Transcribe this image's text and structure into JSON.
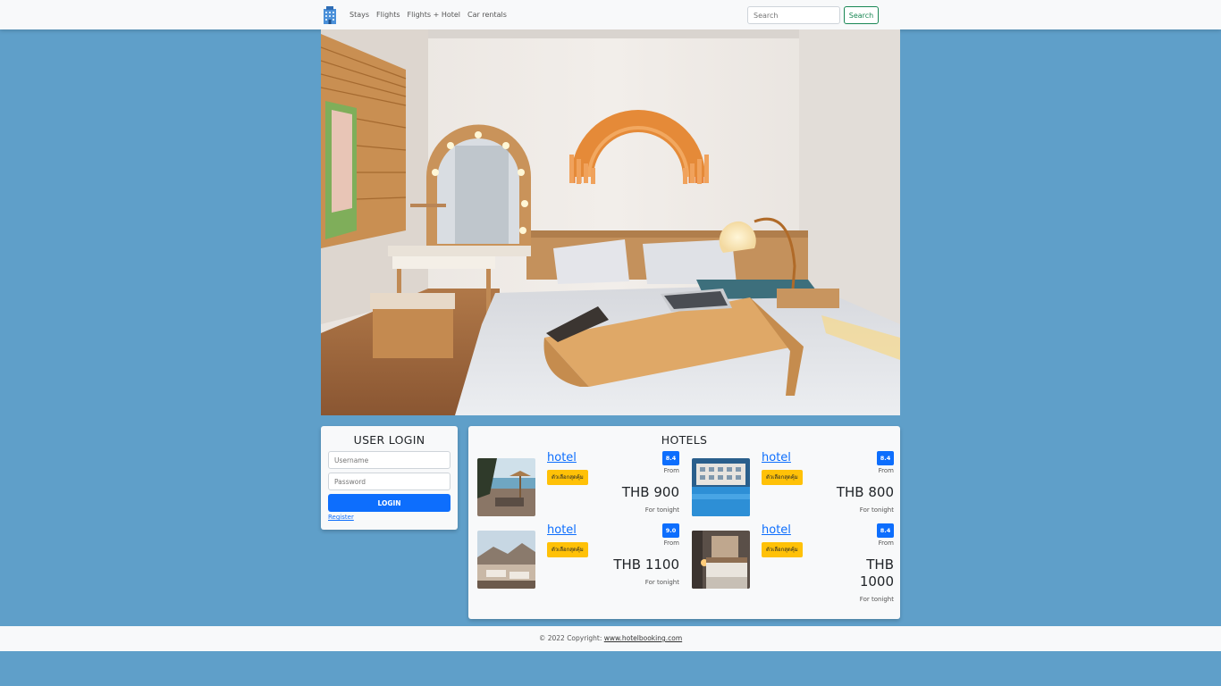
{
  "nav": {
    "items": [
      "Stays",
      "Flights",
      "Flights + Hotel",
      "Car rentals"
    ],
    "search_placeholder": "Search",
    "search_button": "Search"
  },
  "login": {
    "title": "USER LOGIN",
    "username_placeholder": "Username",
    "password_placeholder": "Password",
    "button": "LOGIN",
    "register": "Register"
  },
  "hotels": {
    "title": "HOTELS",
    "items": [
      {
        "name": "hotel",
        "tag": "ตัวเลือกสุดคุ้ม",
        "rating": "8.4",
        "from": "From",
        "price": "THB 900",
        "note": "For tonight"
      },
      {
        "name": "hotel",
        "tag": "ตัวเลือกสุดคุ้ม",
        "rating": "8.4",
        "from": "From",
        "price": "THB 800",
        "note": "For tonight"
      },
      {
        "name": "hotel",
        "tag": "ตัวเลือกสุดคุ้ม",
        "rating": "9.0",
        "from": "From",
        "price": "THB 1100",
        "note": "For tonight"
      },
      {
        "name": "hotel",
        "tag": "ตัวเลือกสุดคุ้ม",
        "rating": "8.4",
        "from": "From",
        "price": "THB 1000",
        "note": "For tonight"
      }
    ]
  },
  "footer": {
    "text": "© 2022 Copyright: ",
    "link": "www.hotelbooking.com"
  },
  "colors": {
    "page_bg": "#5f9fc9",
    "primary": "#0d6efd",
    "tag": "#ffc107",
    "success": "#198754"
  }
}
